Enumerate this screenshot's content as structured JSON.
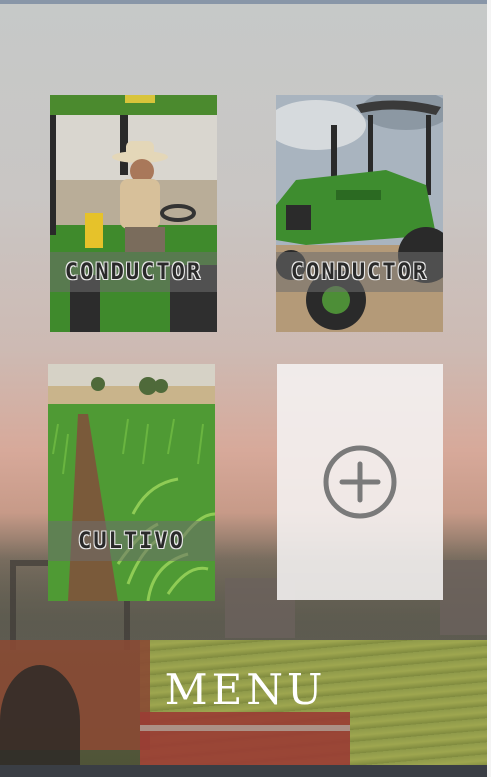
{
  "cards": [
    {
      "label": "CONDUCTOR",
      "icon": "farmer-on-tractor-photo"
    },
    {
      "label": "CONDUCTOR",
      "icon": "green-tractor-photo"
    },
    {
      "label": "CULTIVO",
      "icon": "corn-field-photo"
    }
  ],
  "add_card": {
    "icon": "plus-circle-icon"
  },
  "menu": {
    "title": "MENU"
  },
  "colors": {
    "tractor_green": "#3d8a2e",
    "add_icon": "#7a7a7a",
    "title": "#ffffff"
  }
}
